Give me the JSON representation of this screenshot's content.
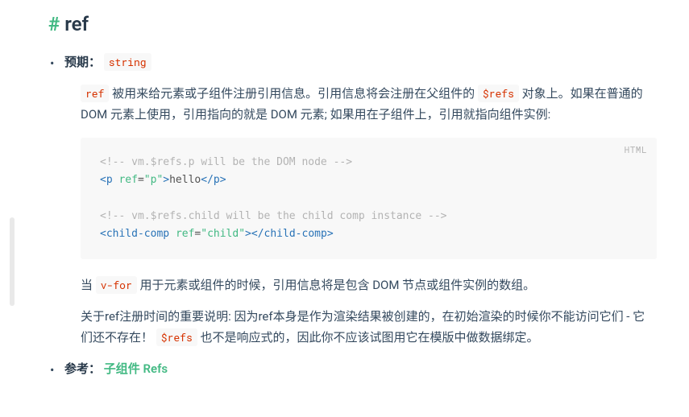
{
  "heading": {
    "hash": "#",
    "text": "ref"
  },
  "li_expected": {
    "label": "预期：",
    "type": "string"
  },
  "desc1": {
    "code1": "ref",
    "t1": " 被用来给元素或子组件注册引用信息。引用信息将会注册在父组件的 ",
    "code2": "$refs",
    "t2": " 对象上。如果在普通的 DOM 元素上使用，引用指向的就是 DOM 元素; 如果用在子组件上，引用就指向组件实例:"
  },
  "codeblock": {
    "lang": "HTML",
    "l1": {
      "raw": "<!-- vm.$refs.p will be the DOM node -->"
    },
    "l2": {
      "o1": "<",
      "t1": "p",
      "sp": " ",
      "a1": "ref",
      "eq": "=",
      "q": "\"",
      "v": "p",
      "c1": ">",
      "tx": "hello",
      "o2": "</",
      "t2": "p",
      "c2": ">"
    },
    "l3": {
      "raw": "<!-- vm.$refs.child will be the child comp instance -->"
    },
    "l4": {
      "o1": "<",
      "t1": "child-comp",
      "sp": " ",
      "a1": "ref",
      "eq": "=",
      "q": "\"",
      "v": "child",
      "c1": ">",
      "o2": "</",
      "t2": "child-comp",
      "c2": ">"
    }
  },
  "desc2": {
    "t1": "当 ",
    "code1": "v-for",
    "t2": " 用于元素或组件的时候，引用信息将是包含 DOM 节点或组件实例的数组。"
  },
  "desc3": {
    "t1": "关于ref注册时间的重要说明: 因为ref本身是作为渲染结果被创建的，在初始渲染的时候你不能访问它们 - 它们还不存在！ ",
    "code1": "$refs",
    "t2": " 也不是响应式的，因此你不应该试图用它在模版中做数据绑定。"
  },
  "li_see": {
    "label": "参考：",
    "link": "子组件 Refs"
  }
}
